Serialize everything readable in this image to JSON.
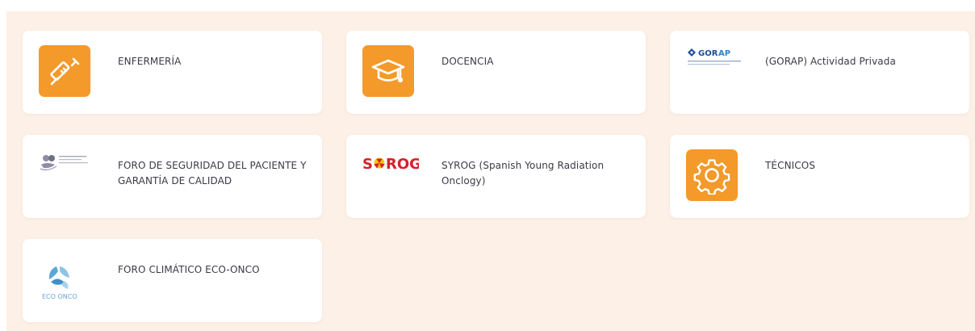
{
  "cards": [
    {
      "label": "ENFERMERÍA",
      "icon": "syringe-icon"
    },
    {
      "label": "DOCENCIA",
      "icon": "graduation-cap-icon"
    },
    {
      "label": "(GORAP) Actividad Privada",
      "logo_text": "GORAP"
    },
    {
      "label": "FORO DE SEGURIDAD DEL PACIENTE Y GARANTÍA DE CALIDAD"
    },
    {
      "label": "SYROG (Spanish Young Radiation Onclogy)",
      "logo_text": "SYROG"
    },
    {
      "label": "TÉCNICOS",
      "icon": "gear-icon"
    },
    {
      "label": "FORO CLIMÁTICO ECO-ONCO",
      "logo_text": "ECO ONCO"
    }
  ],
  "colors": {
    "accent": "#f39a2b",
    "background": "#fdf0e6",
    "card": "#ffffff",
    "text": "#3a3a46"
  }
}
